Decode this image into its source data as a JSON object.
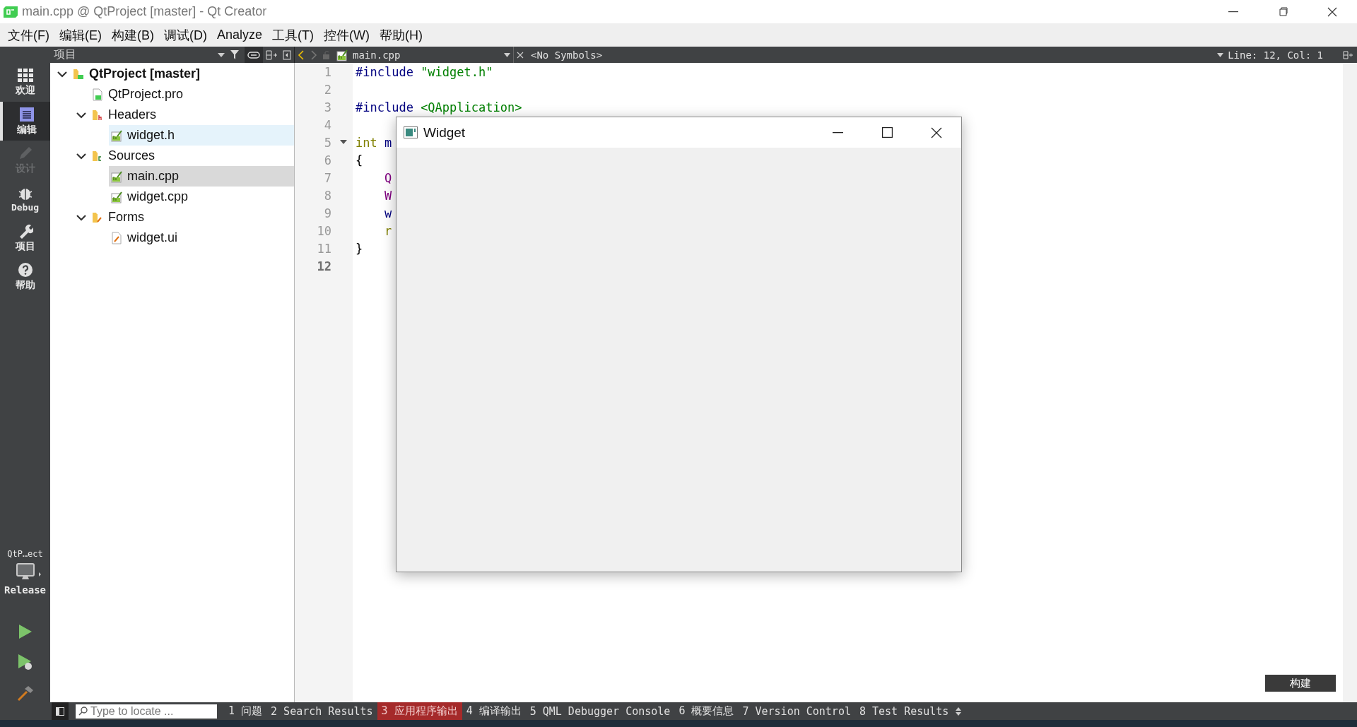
{
  "window": {
    "title": "main.cpp @ QtProject [master] - Qt Creator"
  },
  "menu": [
    "文件(F)",
    "编辑(E)",
    "构建(B)",
    "调试(D)",
    "Analyze",
    "工具(T)",
    "控件(W)",
    "帮助(H)"
  ],
  "modes": [
    {
      "label": "欢迎",
      "kind": "welcome",
      "selected": false,
      "disabled": false
    },
    {
      "label": "编辑",
      "kind": "edit",
      "selected": true,
      "disabled": false
    },
    {
      "label": "设计",
      "kind": "design",
      "selected": false,
      "disabled": true
    },
    {
      "label": "Debug",
      "kind": "debug",
      "selected": false,
      "disabled": false
    },
    {
      "label": "项目",
      "kind": "projects",
      "selected": false,
      "disabled": false
    },
    {
      "label": "帮助",
      "kind": "help",
      "selected": false,
      "disabled": false
    }
  ],
  "target": {
    "project": "QtP…ect",
    "build": "Release"
  },
  "project_pane": {
    "title": "项目",
    "tree": [
      {
        "label": "QtProject [master]",
        "kind": "project",
        "expanded": true,
        "selected": false,
        "hovered": false,
        "children": [
          {
            "label": "QtProject.pro",
            "kind": "pro",
            "selected": false,
            "hovered": false
          },
          {
            "label": "Headers",
            "kind": "headers",
            "expanded": true,
            "selected": false,
            "hovered": false,
            "children": [
              {
                "label": "widget.h",
                "kind": "source",
                "selected": false,
                "hovered": true
              }
            ]
          },
          {
            "label": "Sources",
            "kind": "sources",
            "expanded": true,
            "selected": false,
            "hovered": false,
            "children": [
              {
                "label": "main.cpp",
                "kind": "source",
                "selected": true,
                "hovered": false
              },
              {
                "label": "widget.cpp",
                "kind": "source",
                "selected": false,
                "hovered": false
              }
            ]
          },
          {
            "label": "Forms",
            "kind": "forms",
            "expanded": true,
            "selected": false,
            "hovered": false,
            "children": [
              {
                "label": "widget.ui",
                "kind": "form",
                "selected": false,
                "hovered": false
              }
            ]
          }
        ]
      }
    ]
  },
  "editor": {
    "file": "main.cpp",
    "symbols": "<No Symbols>",
    "position": "Line: 12, Col: 1",
    "lines": [
      {
        "number": "1",
        "current": false,
        "fold": false,
        "tokens": [
          {
            "text": "#include ",
            "kind": "directive"
          },
          {
            "text": "\"widget.h\"",
            "kind": "string"
          }
        ]
      },
      {
        "number": "2",
        "current": false,
        "fold": false
      },
      {
        "number": "3",
        "current": false,
        "fold": false,
        "tokens": [
          {
            "text": "#include ",
            "kind": "directive"
          },
          {
            "text": "<QApplication>",
            "kind": "string"
          }
        ]
      },
      {
        "number": "4",
        "current": false,
        "fold": false
      },
      {
        "number": "5",
        "current": false,
        "fold": true,
        "tokens": [
          {
            "text": "int",
            "kind": "keyword"
          },
          {
            "text": " m",
            "kind": "ident"
          }
        ]
      },
      {
        "number": "6",
        "current": false,
        "fold": false,
        "tokens": [
          {
            "text": "{",
            "kind": "plain"
          }
        ]
      },
      {
        "number": "7",
        "current": false,
        "fold": false,
        "tokens": [
          {
            "text": "    Q",
            "kind": "type"
          }
        ]
      },
      {
        "number": "8",
        "current": false,
        "fold": false,
        "tokens": [
          {
            "text": "    W",
            "kind": "type"
          }
        ]
      },
      {
        "number": "9",
        "current": false,
        "fold": false,
        "tokens": [
          {
            "text": "    w",
            "kind": "ident"
          }
        ]
      },
      {
        "number": "10",
        "current": false,
        "fold": false,
        "tokens": [
          {
            "text": "    r",
            "kind": "keyword"
          }
        ]
      },
      {
        "number": "11",
        "current": false,
        "fold": false,
        "tokens": [
          {
            "text": "}",
            "kind": "plain"
          }
        ]
      },
      {
        "number": "12",
        "current": true,
        "fold": false
      }
    ]
  },
  "app_window": {
    "title": "Widget"
  },
  "output_pane": {
    "search": {
      "placeholder": "Type to locate ..."
    },
    "tabs": [
      {
        "label": "1 问题",
        "selected": false
      },
      {
        "label": "2 Search Results",
        "selected": false
      },
      {
        "label": "3 应用程序输出",
        "selected": true
      },
      {
        "label": "4 编译输出",
        "selected": false
      },
      {
        "label": "5 QML Debugger Console",
        "selected": false
      },
      {
        "label": "6 概要信息",
        "selected": false
      },
      {
        "label": "7 Version Control",
        "selected": false
      },
      {
        "label": "8 Test Results",
        "selected": false
      }
    ]
  },
  "tooltip": "构建"
}
